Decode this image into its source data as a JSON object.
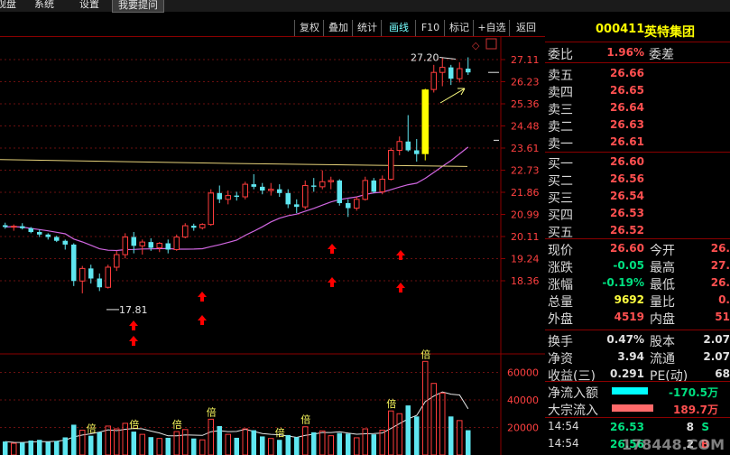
{
  "menu": {
    "items": [
      "观盘",
      "系统",
      "设置",
      "我要提问"
    ]
  },
  "toolbar": {
    "items": [
      "复权",
      "叠加",
      "统计",
      "画线",
      "F10",
      "标记",
      "+自选",
      "返回"
    ],
    "highlighted": "画线"
  },
  "chart": {
    "price_axis": [
      "27.11",
      "26.23",
      "25.36",
      "24.48",
      "23.61",
      "22.73",
      "21.86",
      "20.99",
      "20.11",
      "19.24",
      "18.36"
    ],
    "volume_axis": [
      "60000",
      "40000",
      "20000"
    ],
    "annotations": {
      "high": "27.20",
      "low": "17.81"
    },
    "volume_marker": "倍",
    "colors": {
      "up": "#ff3c3c",
      "down": "#5fe6f0",
      "limit_up": "#ffff00",
      "ma_long": "#e6d27a",
      "ma_mid": "#d066e0",
      "arrow": "#ff0000"
    }
  },
  "panel": {
    "code": "000411",
    "name": "英特集团",
    "weibi": {
      "label": "委比",
      "value": "1.96%",
      "label2": "委差"
    },
    "asks": [
      {
        "label": "卖五",
        "price": "26.66"
      },
      {
        "label": "卖四",
        "price": "26.65"
      },
      {
        "label": "卖三",
        "price": "26.64"
      },
      {
        "label": "卖二",
        "price": "26.63"
      },
      {
        "label": "卖一",
        "price": "26.61"
      }
    ],
    "bids": [
      {
        "label": "买一",
        "price": "26.60"
      },
      {
        "label": "买二",
        "price": "26.56"
      },
      {
        "label": "买三",
        "price": "26.54"
      },
      {
        "label": "买四",
        "price": "26.53"
      },
      {
        "label": "买五",
        "price": "26.52"
      }
    ],
    "stats": [
      {
        "l1": "现价",
        "v1": "26.60",
        "l2": "今开",
        "v2": "26."
      },
      {
        "l1": "涨跌",
        "v1": "-0.05",
        "l2": "最高",
        "v2": "27."
      },
      {
        "l1": "涨幅",
        "v1": "-0.19%",
        "l2": "最低",
        "v2": "26."
      },
      {
        "l1": "总量",
        "v1": "9692",
        "l2": "量比",
        "v2": "0."
      },
      {
        "l1": "外盘",
        "v1": "4519",
        "l2": "内盘",
        "v2": "51"
      }
    ],
    "stats2": [
      {
        "l1": "换手",
        "v1": "0.47%",
        "l2": "股本",
        "v2": "2.07"
      },
      {
        "l1": "净资",
        "v1": "3.94",
        "l2": "流通",
        "v2": "2.07"
      },
      {
        "l1": "收益(三)",
        "v1": "0.291",
        "l2": "PE(动)",
        "v2": "68"
      }
    ],
    "flows": [
      {
        "label": "净流入额",
        "value": "-170.5万"
      },
      {
        "label": "大宗流入",
        "value": "189.7万"
      }
    ],
    "ticks": [
      {
        "time": "14:54",
        "price": "26.53",
        "vol": "8",
        "side": "S"
      },
      {
        "time": "14:54",
        "price": "26.56",
        "vol": "2",
        "side": "B"
      }
    ]
  },
  "watermark": "178448.COM"
}
